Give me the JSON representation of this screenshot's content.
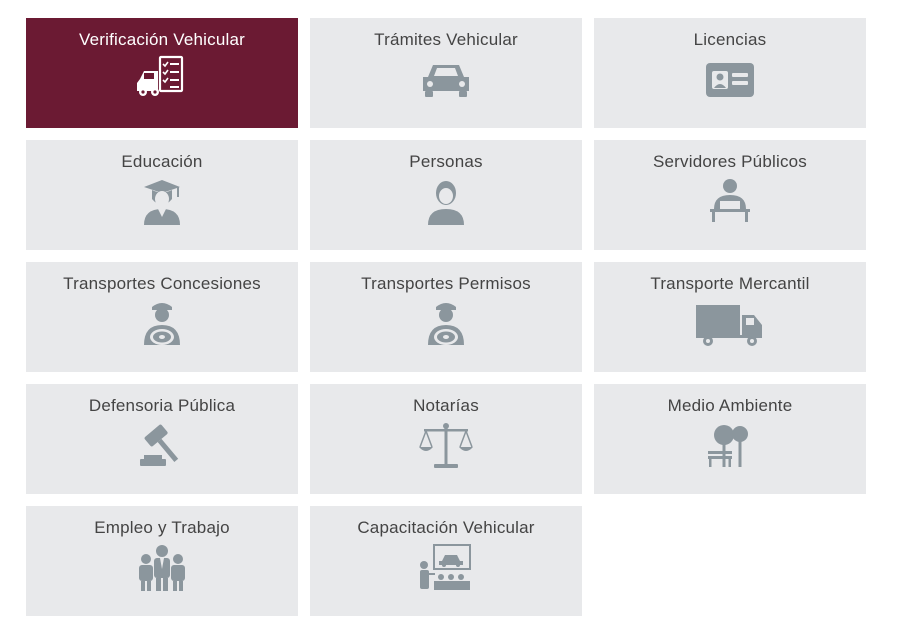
{
  "tiles": [
    {
      "label": "Verificación Vehicular",
      "icon": "car-checklist-icon",
      "active": true
    },
    {
      "label": "Trámites Vehicular",
      "icon": "car-icon"
    },
    {
      "label": "Licencias",
      "icon": "id-card-icon"
    },
    {
      "label": "Educación",
      "icon": "graduate-icon"
    },
    {
      "label": "Personas",
      "icon": "person-icon"
    },
    {
      "label": "Servidores Públicos",
      "icon": "public-servant-icon"
    },
    {
      "label": "Transportes Concesiones",
      "icon": "driver-icon"
    },
    {
      "label": "Transportes Permisos",
      "icon": "driver-icon"
    },
    {
      "label": "Transporte Mercantil",
      "icon": "truck-icon"
    },
    {
      "label": "Defensoria Pública",
      "icon": "gavel-icon"
    },
    {
      "label": "Notarías",
      "icon": "scales-icon"
    },
    {
      "label": "Medio Ambiente",
      "icon": "park-icon"
    },
    {
      "label": "Empleo y Trabajo",
      "icon": "workers-icon"
    },
    {
      "label": "Capacitación Vehicular",
      "icon": "training-icon"
    }
  ],
  "colors": {
    "active_bg": "#6b1a33",
    "tile_bg": "#e8e9eb",
    "icon_gray": "#8b969d",
    "label_gray": "#444444"
  }
}
